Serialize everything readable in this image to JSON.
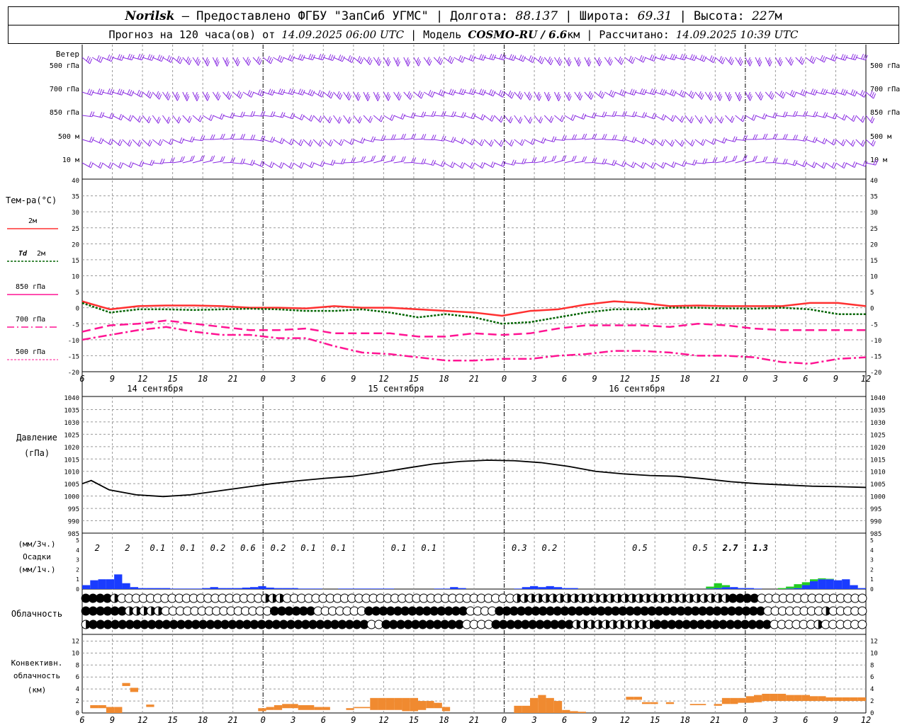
{
  "header": {
    "station": "Norilsk",
    "provider": "– Предоставлено ФГБУ \"ЗапСиб УГМС\"",
    "lon_label": "| Долгота:",
    "lon": "88.137",
    "lat_label": "| Широта:",
    "lat": "69.31",
    "alt_label": "| Высота:",
    "alt": "227",
    "alt_unit": "м",
    "forecast_label": "Прогноз на 120 часа(ов) от",
    "forecast_start": "14.09.2025 06:00 UTC",
    "model_label": "| Модель",
    "model": "COSMO-RU / 6.6",
    "model_unit": "км",
    "calc_label": "| Рассчитано:",
    "calc_time": "14.09.2025 10:39 UTC"
  },
  "colors": {
    "wind": "#8a2be2",
    "t2m": "#ff3030",
    "td2m": "#006400",
    "t850": "#ff1493",
    "t700": "#ff1493",
    "t500": "#ff1493",
    "precip": "#1a3cff",
    "precip_conv": "#22cc22",
    "convective": "#f08a30",
    "grid": "#9a9a9a"
  },
  "chart_data": [
    {
      "panel": "wind",
      "type": "wind-barbs",
      "title": "Ветер",
      "levels": [
        "500 гПа",
        "700 гПа",
        "850 гПа",
        "500 м",
        "10 м"
      ]
    },
    {
      "panel": "temperature",
      "type": "line",
      "title": "Тем-ра(°C)",
      "ylim": [
        -20,
        40
      ],
      "y_ticks": [
        "40",
        "35",
        "30",
        "25",
        "20",
        "15",
        "10",
        "5",
        "0",
        "-5",
        "-10",
        "-15",
        "-20"
      ],
      "x_tick_labels": [
        "6",
        "9",
        "12",
        "15",
        "18",
        "21",
        "0",
        "3",
        "6",
        "9",
        "12",
        "15",
        "18",
        "21",
        "0",
        "3",
        "6",
        "9",
        "12",
        "15",
        "18",
        "21",
        "0",
        "3",
        "6",
        "9",
        "12"
      ],
      "day_labels": [
        "14 сентября",
        "15 сентября",
        "16 сентября"
      ],
      "x_hours": [
        0,
        3,
        6,
        9,
        12,
        15,
        18,
        21,
        24,
        27,
        30,
        33,
        36,
        39,
        42,
        45,
        48,
        51,
        54,
        57,
        60,
        63,
        66,
        69,
        72,
        75,
        78
      ],
      "series": [
        {
          "name": "2м",
          "values": [
            2,
            -0.5,
            0.5,
            0.7,
            0.7,
            0.5,
            0,
            0,
            -0.2,
            0.5,
            0,
            0,
            -0.5,
            -1,
            -1.5,
            -2.5,
            -1,
            -0.5,
            1,
            2,
            1.5,
            0.5,
            0.7,
            0.5,
            0.5,
            0.5,
            1.5,
            1.5,
            0.5
          ]
        },
        {
          "name": "Td 2м",
          "values": [
            1.5,
            -1.5,
            -0.5,
            -0.5,
            -0.7,
            -0.5,
            -0.3,
            -0.5,
            -1,
            -1,
            -0.5,
            -1.5,
            -3,
            -2,
            -3,
            -5,
            -4.5,
            -3,
            -1.5,
            -0.5,
            -0.5,
            0,
            0,
            -0.2,
            -0.3,
            0,
            -0.5,
            -2,
            -2
          ]
        },
        {
          "name": "850 гПа",
          "values": [
            -7.5,
            -5.5,
            -5,
            -4,
            -5,
            -6,
            -7,
            -7,
            -6.5,
            -8,
            -8,
            -8,
            -9,
            -9,
            -8,
            -8.5,
            -8,
            -6.5,
            -5.5,
            -5.5,
            -5.5,
            -6,
            -5,
            -5.5,
            -6.5,
            -7,
            -7,
            -7,
            -7
          ]
        },
        {
          "name": "700 гПа",
          "values": [
            -10,
            -8.5,
            -7,
            -6,
            -7.5,
            -8.5,
            -8.5,
            -9.5,
            -9.5,
            -12,
            -14,
            -14.5,
            -15.5,
            -16.5,
            -16.5,
            -16,
            -16,
            -15,
            -14.5,
            -13.5,
            -13.5,
            -14,
            -15,
            -15,
            -15.5,
            -17,
            -17.5,
            -16,
            -15.5
          ]
        },
        {
          "name": "500 гПа",
          "values": []
        }
      ]
    },
    {
      "panel": "pressure",
      "type": "line",
      "title": "Давление",
      "ylabel": "(гПа)",
      "ylim": [
        985,
        1040
      ],
      "y_ticks": [
        "1040",
        "1035",
        "1030",
        "1025",
        "1020",
        "1015",
        "1010",
        "1005",
        "1000",
        "995",
        "990",
        "985"
      ],
      "x_hours": [
        0,
        3,
        6,
        9,
        12,
        15,
        18,
        21,
        24,
        27,
        30,
        33,
        36,
        39,
        42,
        45,
        48,
        51,
        54,
        57,
        60,
        63,
        66,
        69,
        72,
        75,
        78
      ],
      "values": [
        1005,
        1006.3,
        1002.5,
        1000.5,
        999.8,
        1000.5,
        1002,
        1003.5,
        1005,
        1006.2,
        1007.2,
        1008,
        1009.5,
        1011.3,
        1013,
        1014,
        1014.5,
        1014.3,
        1013.5,
        1012,
        1010,
        1009,
        1008.3,
        1008,
        1007,
        1005.8,
        1005,
        1004.5,
        1004,
        1003.8,
        1003.5
      ],
      "x_hours_fine": [
        0,
        1,
        3,
        6,
        9,
        12,
        15,
        18,
        21,
        24,
        27,
        30,
        33,
        36,
        39,
        42,
        45,
        48,
        51,
        54,
        57,
        60,
        63,
        66,
        69,
        72,
        75,
        78,
        81,
        84,
        87
      ]
    },
    {
      "panel": "precipitation",
      "type": "bar",
      "title": "Осадки",
      "ylabel_top": "(мм/3ч.)",
      "ylabel_bottom": "(мм/1ч.)",
      "ylim": [
        0,
        5
      ],
      "y_ticks": [
        "5",
        "4",
        "3",
        "2",
        "1",
        "0"
      ],
      "totals_3h": [
        "2",
        "2",
        "0.1",
        "0.1",
        "0.2",
        "0.6",
        "0.2",
        "0.1",
        "0.1",
        "0.1",
        "0.1",
        "0.3",
        "0.2",
        "0.5",
        "0.5",
        "2.7",
        "1.3"
      ],
      "totals_3h_hours": [
        1.5,
        4.5,
        7.5,
        10.5,
        13.5,
        16.5,
        19.5,
        22.5,
        25.5,
        31.5,
        34.5,
        43.5,
        46.5,
        55.5,
        61.5,
        64.5,
        67.5
      ],
      "hourly_large_scale": [
        0.4,
        0.9,
        1.0,
        1.0,
        1.5,
        0.6,
        0.2,
        0.1,
        0.1,
        0.1,
        0.1,
        0.05,
        0.05,
        0.05,
        0.05,
        0.1,
        0.2,
        0.1,
        0.1,
        0.1,
        0.15,
        0.2,
        0.3,
        0.15,
        0.1,
        0.1,
        0.1,
        0.05,
        0.05,
        0.05,
        0,
        0,
        0.05,
        0.05,
        0.05,
        0.05,
        0.05,
        0.05,
        0.05,
        0,
        0,
        0,
        0,
        0,
        0.05,
        0.05,
        0.2,
        0.1,
        0,
        0,
        0,
        0,
        0,
        0,
        0.05,
        0.2,
        0.3,
        0.2,
        0.3,
        0.2,
        0.1,
        0.1,
        0,
        0,
        0,
        0,
        0,
        0,
        0,
        0,
        0,
        0,
        0,
        0,
        0,
        0,
        0,
        0,
        0.05,
        0.1,
        0.2,
        0.2,
        0.1,
        0.1,
        0.05,
        0,
        0,
        0,
        0.05,
        0.1,
        0.4,
        0.8,
        1.0,
        1.0,
        0.9,
        1.0,
        0.4,
        0.1
      ],
      "hourly_convective": [
        0,
        0,
        0,
        0,
        0,
        0,
        0,
        0,
        0,
        0,
        0,
        0,
        0,
        0,
        0,
        0,
        0,
        0,
        0,
        0,
        0,
        0,
        0,
        0,
        0,
        0,
        0,
        0,
        0,
        0,
        0,
        0,
        0,
        0,
        0,
        0,
        0,
        0,
        0,
        0,
        0,
        0,
        0,
        0,
        0,
        0,
        0,
        0,
        0,
        0,
        0,
        0,
        0,
        0,
        0,
        0,
        0,
        0,
        0,
        0,
        0,
        0,
        0,
        0,
        0,
        0,
        0,
        0,
        0,
        0,
        0,
        0,
        0,
        0,
        0,
        0,
        0,
        0,
        0.2,
        0.5,
        0.2,
        0,
        0,
        0,
        0,
        0,
        0,
        0.1,
        0.2,
        0.4,
        0.3,
        0.2,
        0.1,
        0.05,
        0,
        0,
        0,
        0
      ]
    },
    {
      "panel": "cloudiness",
      "type": "symbols",
      "title": "Облачность",
      "rows": [
        "BBBBHEEEEEEEEEEEEEEEEEEEEHHHEEEEEEEEEEEEEEEEEEEEEEEEEEEEEEEEHHHHHHHHHHHHHHHHHHHHHHHHHHHHHHBBBBEEEEEEEEEEEEEEE",
        "BBBBBBHHHHHEEEEEEEEEEEEEEEBBBBBBEEEEEEEBBBBBBBBBBBBBBEEEEBBBBBBBBBBBBBBBBBBBBBBBBBBBBBBBBBBBBBEEEEEEEEHEEEEE",
        "HBBBBBBBBBBBBBBBBBBBBBBBBBBBBBBBBBBBBBBEEBBBBBBBBBBBEEEEBBBBBBBBBBBHHHHHHHHHHHBBBBBBBBBBBBBBBBEEEEEEHEEEEEE"
      ]
    },
    {
      "panel": "convective",
      "type": "bar",
      "title": "Конвективн.",
      "title2": "облачность",
      "ylabel": "(км)",
      "ylim": [
        0,
        13
      ],
      "y_ticks": [
        "12",
        "10",
        "8",
        "6",
        "4",
        "2",
        "0"
      ],
      "hourly_bottom": [
        0,
        0.8,
        0.8,
        0,
        0,
        4.5,
        3.5,
        0,
        1.0,
        0,
        0.3,
        0.3,
        0.3,
        0.3,
        0.3,
        0.3,
        0.3,
        0.2,
        0.2,
        0.2,
        0.3,
        0.3,
        0.3,
        0.5,
        0.5,
        0.8,
        0.8,
        0.5,
        0.5,
        0.5,
        0.5,
        0.5,
        0.5,
        0.5,
        0.8,
        0.8,
        0.5,
        0.5,
        0.5,
        0.5,
        0.3,
        0.3,
        0.5,
        0.8,
        0.8,
        0.3,
        0.3,
        0.2,
        0,
        0,
        0,
        0,
        0,
        0,
        0,
        0,
        0,
        0,
        0,
        0,
        0,
        0,
        0,
        0,
        0,
        0,
        0,
        0,
        2.2,
        2.2,
        1.5,
        1.5,
        1.5,
        1.5,
        1.2,
        1.2,
        1.3,
        1.3,
        1.2,
        1.2,
        1.5,
        1.5,
        1.7,
        1.7,
        1.8,
        2.0,
        2.0,
        2.0,
        2.0,
        2.0,
        2.0,
        2.0,
        2.0,
        2.0,
        2.0,
        2.0,
        2.0,
        2.0
      ],
      "hourly_top": [
        0,
        1.3,
        1.3,
        1.0,
        1.0,
        5.0,
        4.2,
        0,
        1.4,
        0,
        0.3,
        0.3,
        0.3,
        0.3,
        0.3,
        0.3,
        0.3,
        0.2,
        0.2,
        0.2,
        0.3,
        0.3,
        0.8,
        1.0,
        1.3,
        1.5,
        1.5,
        1.3,
        1.3,
        1.0,
        1.0,
        0.5,
        0.5,
        0.8,
        1.0,
        1.0,
        2.5,
        2.5,
        2.5,
        2.5,
        2.5,
        2.5,
        2.0,
        2.0,
        1.7,
        1.0,
        0.3,
        0.2,
        0,
        0,
        0,
        0,
        0,
        0,
        1.2,
        1.2,
        2.5,
        3.0,
        2.5,
        2.0,
        0.5,
        0.3,
        0.2,
        0,
        0,
        0,
        0,
        0,
        2.7,
        2.7,
        1.8,
        1.8,
        1.5,
        1.8,
        1.2,
        1.2,
        1.5,
        1.5,
        1.2,
        1.5,
        2.5,
        2.5,
        2.5,
        2.8,
        3.0,
        3.2,
        3.2,
        3.2,
        3.0,
        3.0,
        3.0,
        2.8,
        2.8,
        2.6,
        2.6,
        2.6,
        2.6,
        2.6
      ]
    }
  ],
  "legend": {
    "t2m_label": "2м",
    "td_label": "Td",
    "td_label2": "2м",
    "t850_label": "850 гПа",
    "t700_label": "700 гПа",
    "t500_label": "500 гПа"
  }
}
